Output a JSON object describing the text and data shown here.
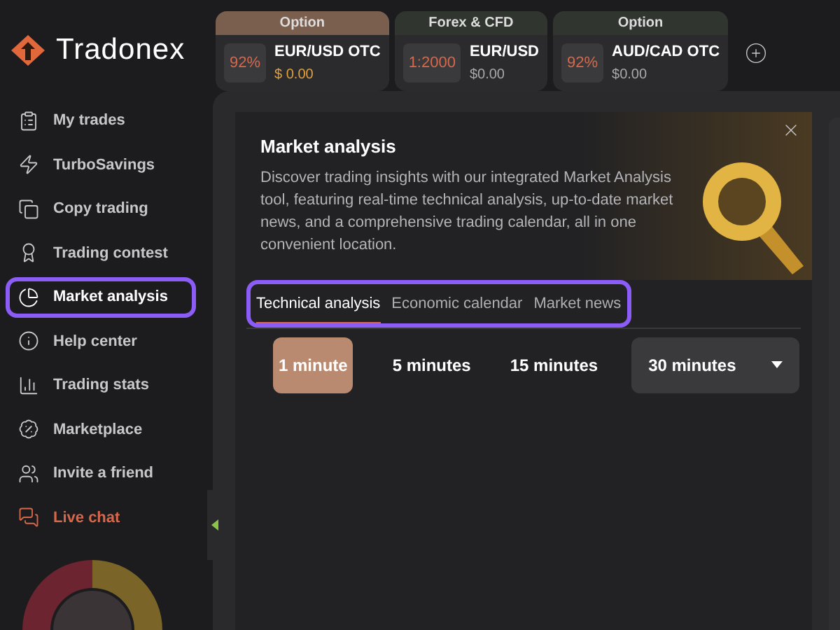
{
  "brand": {
    "name": "Tradonex"
  },
  "assets": [
    {
      "category": "Option",
      "payout": "92%",
      "symbol": "EUR/USD OTC",
      "amount": "$ 0.00",
      "selected": true
    },
    {
      "category": "Forex & CFD",
      "payout": "1:2000",
      "symbol": "EUR/USD",
      "amount": "$0.00",
      "selected": false
    },
    {
      "category": "Option",
      "payout": "92%",
      "symbol": "AUD/CAD OTC",
      "amount": "$0.00",
      "selected": false
    }
  ],
  "sidebar": {
    "items": [
      {
        "label": "My trades",
        "kind": "nav",
        "selected": false,
        "highlighted": false
      },
      {
        "label": "TurboSavings",
        "kind": "nav",
        "selected": false,
        "highlighted": false
      },
      {
        "label": "Copy trading",
        "kind": "nav",
        "selected": false,
        "highlighted": false
      },
      {
        "label": "Trading contest",
        "kind": "nav",
        "selected": false,
        "highlighted": false
      },
      {
        "label": "Market analysis",
        "kind": "nav",
        "selected": true,
        "highlighted": true
      },
      {
        "label": "Help center",
        "kind": "nav",
        "selected": false,
        "highlighted": false
      },
      {
        "label": "Trading stats",
        "kind": "nav",
        "selected": false,
        "highlighted": false
      },
      {
        "label": "Marketplace",
        "kind": "nav",
        "selected": false,
        "highlighted": false
      },
      {
        "label": "Invite a friend",
        "kind": "nav",
        "selected": false,
        "highlighted": false
      },
      {
        "label": "Live chat",
        "kind": "chat",
        "selected": false,
        "highlighted": false
      }
    ]
  },
  "dialog": {
    "title": "Market analysis",
    "description": "Discover trading insights with our integrated Market Analysis tool, featuring real-time technical analysis, up-to-date market news, and a comprehensive trading calendar, all in one convenient location.",
    "tabs_highlighted": true,
    "tabs": [
      {
        "label": "Technical analysis",
        "selected": true
      },
      {
        "label": "Economic calendar",
        "selected": false
      },
      {
        "label": "Market news",
        "selected": false
      }
    ],
    "timeframes": [
      {
        "label": "1 minute",
        "kind": "button",
        "selected": true
      },
      {
        "label": "5 minutes",
        "kind": "button",
        "selected": false
      },
      {
        "label": "15 minutes",
        "kind": "button",
        "selected": false
      },
      {
        "label": "30 minutes",
        "kind": "dropdown",
        "selected": false
      }
    ]
  }
}
